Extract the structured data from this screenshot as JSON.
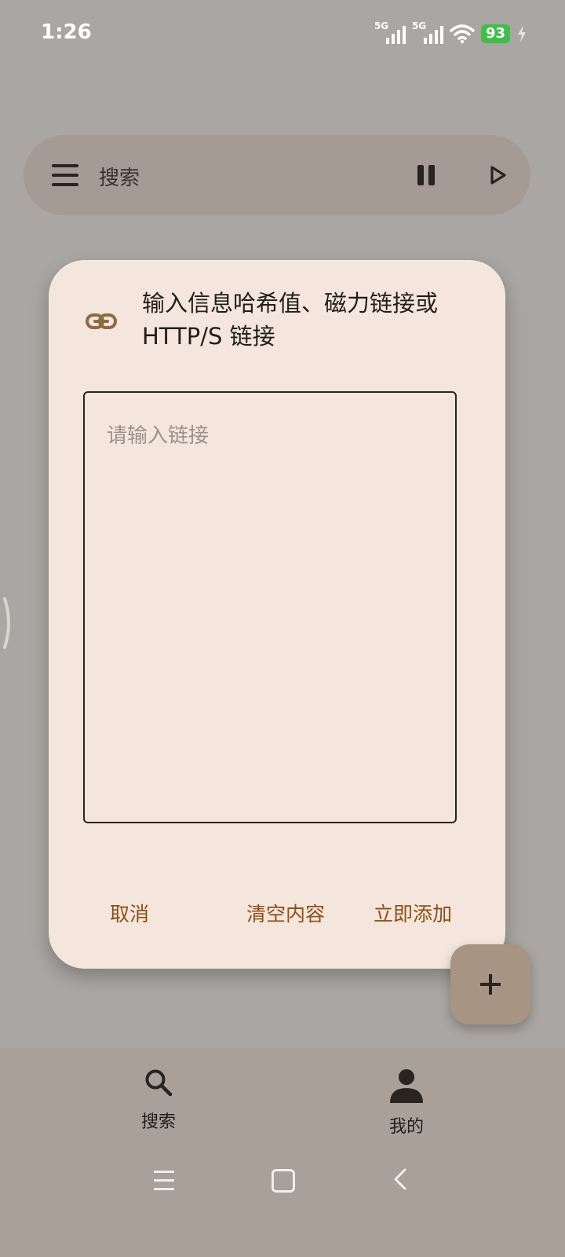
{
  "status_bar": {
    "time": "1:26",
    "sim1_label": "5G",
    "sim2_label": "5G",
    "battery": "93",
    "icons": [
      "signal-icon",
      "signal-icon",
      "wifi-icon",
      "battery-icon",
      "charging-icon"
    ]
  },
  "search_bar": {
    "label": "搜索",
    "icons": [
      "menu-icon",
      "pause-icon",
      "play-icon"
    ]
  },
  "dialog": {
    "title": "输入信息哈希值、磁力链接或 HTTP/S 链接",
    "input": {
      "placeholder": "请输入链接",
      "value": ""
    },
    "buttons": {
      "cancel": "取消",
      "clear": "清空内容",
      "add": "立即添加"
    },
    "icon": "link-icon"
  },
  "fab": {
    "icon": "plus-icon"
  },
  "bottom_nav": {
    "items": [
      {
        "label": "搜索",
        "icon": "search-icon"
      },
      {
        "label": "我的",
        "icon": "person-icon"
      }
    ]
  },
  "system_nav": {
    "icons": [
      "recents-icon",
      "home-icon",
      "back-icon"
    ]
  },
  "colors": {
    "background": "#aaa6a3",
    "dialog": "#f4e6dc",
    "accent_text": "#8a4f18",
    "fab": "#a89482",
    "battery": "#3fbf4a"
  }
}
